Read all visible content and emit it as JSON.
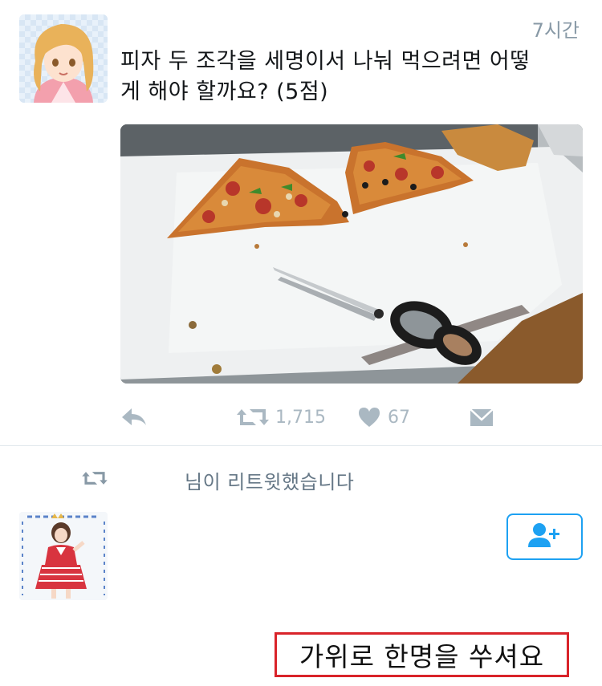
{
  "tweet": {
    "time": "7시간",
    "text_line1": "피자 두 조각을 세명이서 나눠 먹으려면 어떻",
    "text_line2": "게 해야 할까요? (5점)",
    "actions": {
      "reply_icon": "reply-icon",
      "retweet_icon": "retweet-icon",
      "retweet_count": "1,715",
      "like_icon": "heart-icon",
      "like_count": "67",
      "dm_icon": "envelope-icon"
    }
  },
  "retweet_notice": {
    "icon": "retweet-icon",
    "text": "님이 리트윗했습니다"
  },
  "follow_button": {
    "icon": "add-user-icon"
  },
  "caption": {
    "text": "가위로 한명을 쑤셔요",
    "border_color": "#d9232a"
  },
  "colors": {
    "accent": "#1da1f2",
    "icon_gray": "#aab8c2",
    "meta_gray": "#8899a6"
  }
}
